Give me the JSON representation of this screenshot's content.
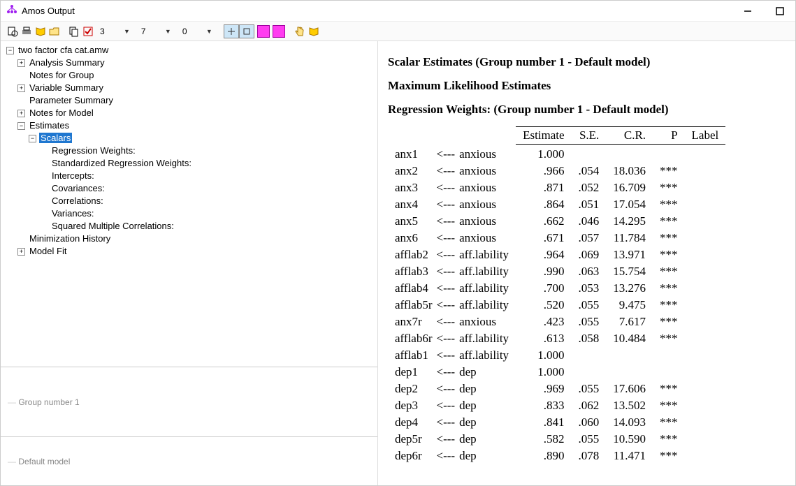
{
  "window": {
    "title": "Amos Output"
  },
  "toolbar": {
    "combo1": "3",
    "combo2": "7",
    "combo3": "0"
  },
  "tree": {
    "root": "two factor cfa cat.amw",
    "items": {
      "analysis_summary": "Analysis Summary",
      "notes_group": "Notes for Group",
      "variable_summary": "Variable Summary",
      "parameter_summary": "Parameter Summary",
      "notes_model": "Notes for Model",
      "estimates": "Estimates",
      "scalars": "Scalars",
      "reg_weights": "Regression Weights:",
      "std_reg_weights": "Standardized Regression Weights:",
      "intercepts": "Intercepts:",
      "covariances": "Covariances:",
      "correlations": "Correlations:",
      "variances": "Variances:",
      "smc": "Squared Multiple Correlations:",
      "min_history": "Minimization History",
      "model_fit": "Model Fit"
    }
  },
  "subpane1": "Group number 1",
  "subpane2": "Default model",
  "content": {
    "h1": "Scalar Estimates (Group number 1 - Default model)",
    "h2": "Maximum Likelihood Estimates",
    "h3": "Regression Weights: (Group number 1 - Default model)",
    "headers": {
      "estimate": "Estimate",
      "se": "S.E.",
      "cr": "C.R.",
      "p": "P",
      "label": "Label"
    },
    "arrow": "<---",
    "rows": [
      {
        "var": "anx1",
        "factor": "anxious",
        "est": "1.000",
        "se": "",
        "cr": "",
        "p": "",
        "lbl": ""
      },
      {
        "var": "anx2",
        "factor": "anxious",
        "est": ".966",
        "se": ".054",
        "cr": "18.036",
        "p": "***",
        "lbl": ""
      },
      {
        "var": "anx3",
        "factor": "anxious",
        "est": ".871",
        "se": ".052",
        "cr": "16.709",
        "p": "***",
        "lbl": ""
      },
      {
        "var": "anx4",
        "factor": "anxious",
        "est": ".864",
        "se": ".051",
        "cr": "17.054",
        "p": "***",
        "lbl": ""
      },
      {
        "var": "anx5",
        "factor": "anxious",
        "est": ".662",
        "se": ".046",
        "cr": "14.295",
        "p": "***",
        "lbl": ""
      },
      {
        "var": "anx6",
        "factor": "anxious",
        "est": ".671",
        "se": ".057",
        "cr": "11.784",
        "p": "***",
        "lbl": ""
      },
      {
        "var": "afflab2",
        "factor": "aff.lability",
        "est": ".964",
        "se": ".069",
        "cr": "13.971",
        "p": "***",
        "lbl": ""
      },
      {
        "var": "afflab3",
        "factor": "aff.lability",
        "est": ".990",
        "se": ".063",
        "cr": "15.754",
        "p": "***",
        "lbl": ""
      },
      {
        "var": "afflab4",
        "factor": "aff.lability",
        "est": ".700",
        "se": ".053",
        "cr": "13.276",
        "p": "***",
        "lbl": ""
      },
      {
        "var": "afflab5r",
        "factor": "aff.lability",
        "est": ".520",
        "se": ".055",
        "cr": "9.475",
        "p": "***",
        "lbl": ""
      },
      {
        "var": "anx7r",
        "factor": "anxious",
        "est": ".423",
        "se": ".055",
        "cr": "7.617",
        "p": "***",
        "lbl": ""
      },
      {
        "var": "afflab6r",
        "factor": "aff.lability",
        "est": ".613",
        "se": ".058",
        "cr": "10.484",
        "p": "***",
        "lbl": ""
      },
      {
        "var": "afflab1",
        "factor": "aff.lability",
        "est": "1.000",
        "se": "",
        "cr": "",
        "p": "",
        "lbl": ""
      },
      {
        "var": "dep1",
        "factor": "dep",
        "est": "1.000",
        "se": "",
        "cr": "",
        "p": "",
        "lbl": ""
      },
      {
        "var": "dep2",
        "factor": "dep",
        "est": ".969",
        "se": ".055",
        "cr": "17.606",
        "p": "***",
        "lbl": ""
      },
      {
        "var": "dep3",
        "factor": "dep",
        "est": ".833",
        "se": ".062",
        "cr": "13.502",
        "p": "***",
        "lbl": ""
      },
      {
        "var": "dep4",
        "factor": "dep",
        "est": ".841",
        "se": ".060",
        "cr": "14.093",
        "p": "***",
        "lbl": ""
      },
      {
        "var": "dep5r",
        "factor": "dep",
        "est": ".582",
        "se": ".055",
        "cr": "10.590",
        "p": "***",
        "lbl": ""
      },
      {
        "var": "dep6r",
        "factor": "dep",
        "est": ".890",
        "se": ".078",
        "cr": "11.471",
        "p": "***",
        "lbl": ""
      }
    ]
  }
}
